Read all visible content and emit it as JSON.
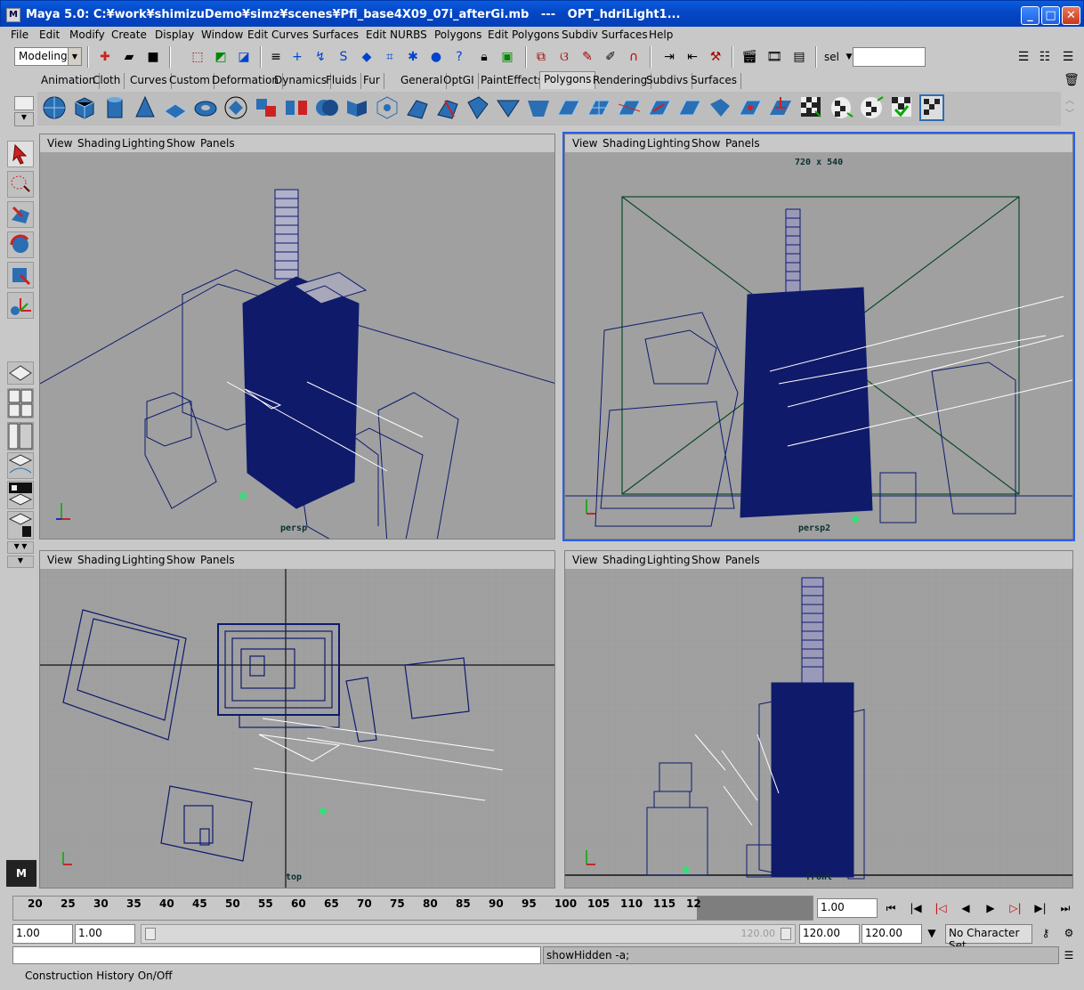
{
  "window": {
    "title": "Maya 5.0: C:¥work¥shimizuDemo¥simz¥scenes¥Pfi_base4X09_07i_afterGi.mb   ---   OPT_hdriLight1...",
    "icon_text": "M",
    "minimize": "_",
    "maximize": "□",
    "close": "✕"
  },
  "menu": [
    "File",
    "Edit",
    "Modify",
    "Create",
    "Display",
    "Window",
    "Edit Curves",
    "Surfaces",
    "Edit NURBS",
    "Polygons",
    "Edit Polygons",
    "Subdiv Surfaces",
    "Help"
  ],
  "toolbar": {
    "mode": "Modeling",
    "sel_label": "sel",
    "sel_value": ""
  },
  "shelf_tabs": [
    "Animation",
    "Cloth",
    "Curves",
    "Custom",
    "Deformation",
    "Dynamics",
    "Fluids",
    "Fur",
    "General",
    "OptGI",
    "PaintEffects",
    "Polygons",
    "Rendering",
    "Subdivs",
    "Surfaces"
  ],
  "active_shelf_tab": "Polygons",
  "viewport_menu": [
    "View",
    "Shading",
    "Lighting",
    "Show",
    "Panels"
  ],
  "viewports": {
    "tl": {
      "camera": "persp"
    },
    "tr": {
      "camera": "persp2",
      "resolution": "720 x 540"
    },
    "bl": {
      "camera": "top"
    },
    "br": {
      "camera": "front"
    }
  },
  "timeline": {
    "ticks": [
      "20",
      "25",
      "30",
      "35",
      "40",
      "45",
      "50",
      "55",
      "60",
      "65",
      "70",
      "75",
      "80",
      "85",
      "90",
      "95",
      "100",
      "105",
      "110",
      "115",
      "12"
    ],
    "current_frame": "1.00"
  },
  "range": {
    "start": "1.00",
    "playback_start": "1.00",
    "slider_value": "120.00",
    "playback_end": "120.00",
    "end": "120.00",
    "character_set": "No Character Set"
  },
  "command_line": {
    "input": "",
    "result": "showHidden -a;"
  },
  "help_line": "Construction History On/Off",
  "colors": {
    "wire": "#0d1a6e",
    "viewport_bg": "#a0a0a0",
    "grid_line": "#9c9c9c",
    "active_border": "#2a5ee8"
  }
}
